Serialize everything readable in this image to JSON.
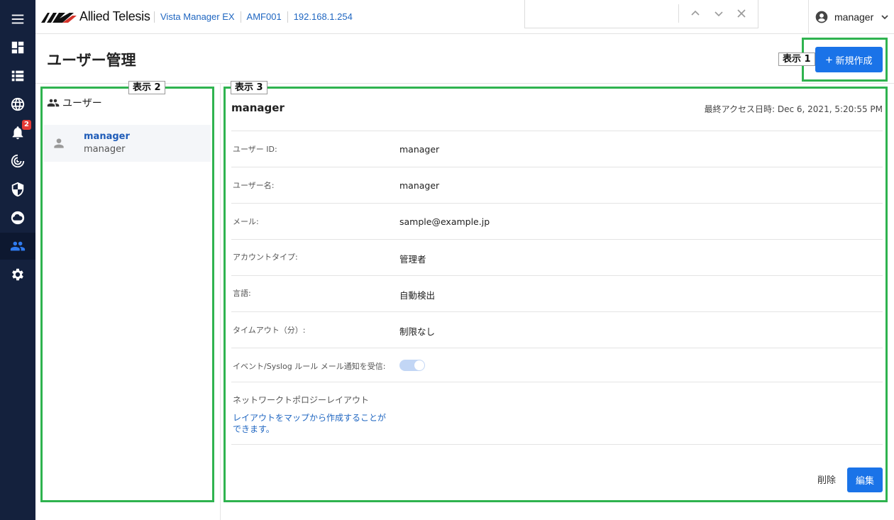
{
  "header": {
    "brand": "Allied Telesis",
    "breadcrumbs": [
      "Vista Manager EX",
      "AMF001",
      "192.168.1.254"
    ],
    "user": "manager"
  },
  "nav": {
    "alerts_badge": "2"
  },
  "page": {
    "title": "ユーザー管理",
    "new_button": "新規作成",
    "new_plus": "+"
  },
  "annotations": {
    "tag1": "表示 1",
    "tag2": "表示 2",
    "tag3": "表示 3",
    "color": "#2fb34f"
  },
  "users_panel": {
    "heading": "ユーザー",
    "items": [
      {
        "name": "manager",
        "subtitle": "manager"
      }
    ]
  },
  "detail": {
    "title": "manager",
    "last_access": "最終アクセス日時: Dec 6, 2021, 5:20:55 PM",
    "fields": [
      {
        "label": "ユーザー ID:",
        "value": "manager"
      },
      {
        "label": "ユーザー名:",
        "value": "manager"
      },
      {
        "label": "メール:",
        "value": "sample@example.jp"
      },
      {
        "label": "アカウントタイプ:",
        "value": "管理者"
      },
      {
        "label": "言語:",
        "value": "自動検出"
      },
      {
        "label": "タイムアウト（分）:",
        "value": "制限なし"
      },
      {
        "label": "イベント/Syslog ルール メール通知を受信:",
        "value": ""
      }
    ],
    "notification_toggle": "on",
    "topology_label": "ネットワークトポロジーレイアウト",
    "topology_link": "レイアウトをマップから作成することができます。",
    "delete_button": "削除",
    "edit_button": "編集"
  },
  "colors": {
    "rail": "#14213d",
    "primary": "#1a73e8",
    "link": "#1f66c1"
  }
}
